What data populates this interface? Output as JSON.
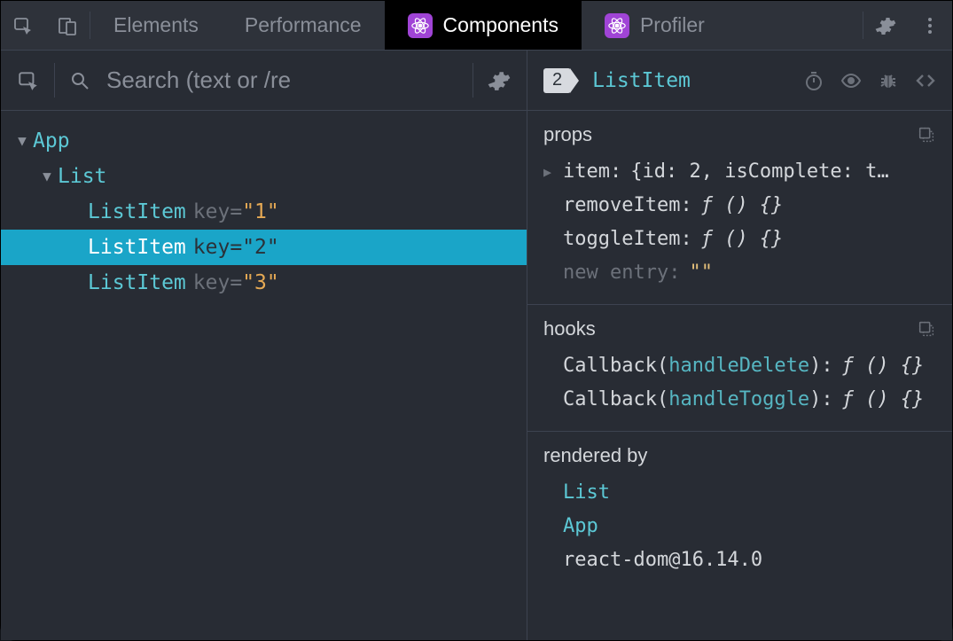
{
  "topbar": {
    "tabs": {
      "elements": "Elements",
      "performance": "Performance",
      "components": "Components",
      "profiler": "Profiler"
    }
  },
  "left": {
    "search_placeholder": "Search (text or /re"
  },
  "tree": {
    "root": {
      "name": "App"
    },
    "list": {
      "name": "List"
    },
    "item1": {
      "name": "ListItem",
      "keyLabel": "key",
      "keyVal": "\"1\""
    },
    "item2": {
      "name": "ListItem",
      "keyLabel": "key",
      "keyVal": "\"2\""
    },
    "item3": {
      "name": "ListItem",
      "keyLabel": "key",
      "keyVal": "\"3\""
    }
  },
  "selected": {
    "badge": "2",
    "name": "ListItem"
  },
  "props": {
    "title": "props",
    "item": {
      "k": "item",
      "v": "{id: 2, isComplete: t…"
    },
    "removeItem": {
      "k": "removeItem",
      "v": "ƒ () {}"
    },
    "toggleItem": {
      "k": "toggleItem",
      "v": "ƒ () {}"
    },
    "newEntry": {
      "k": "new entry",
      "v": "\"\""
    }
  },
  "hooks": {
    "title": "hooks",
    "h1": {
      "kind": "Callback",
      "arg": "handleDelete",
      "v": "ƒ () {}"
    },
    "h2": {
      "kind": "Callback",
      "arg": "handleToggle",
      "v": "ƒ () {}"
    }
  },
  "rendered": {
    "title": "rendered by",
    "r1": "List",
    "r2": "App",
    "r3": "react-dom@16.14.0"
  }
}
